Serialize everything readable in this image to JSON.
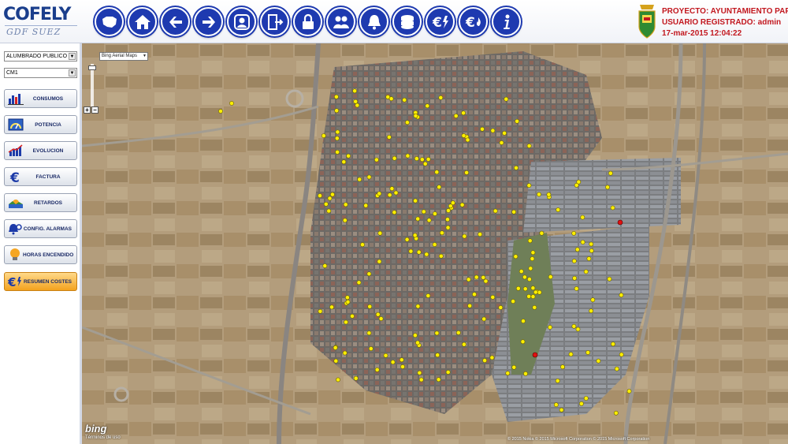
{
  "logo": {
    "main": "COFELY",
    "sub": "GDF SUEZ"
  },
  "toolbar": [
    {
      "name": "spain-map-icon",
      "label": ""
    },
    {
      "name": "home-icon",
      "label": ""
    },
    {
      "name": "arrow-left-icon",
      "label": ""
    },
    {
      "name": "arrow-right-icon",
      "label": ""
    },
    {
      "name": "user-profile-icon",
      "label": ""
    },
    {
      "name": "exit-door-icon",
      "label": ""
    },
    {
      "name": "lock-icon",
      "label": ""
    },
    {
      "name": "users-icon",
      "label": ""
    },
    {
      "name": "alarm-bell-icon",
      "label": ""
    },
    {
      "name": "coins-icon",
      "label": ""
    },
    {
      "name": "euro-electric-icon",
      "label": ""
    },
    {
      "name": "euro-flame-icon",
      "label": ""
    },
    {
      "name": "info-icon",
      "label": ""
    }
  ],
  "project": {
    "line1": "PROYECTO: AYUNTAMIENTO PARLA",
    "line2": "USUARIO REGISTRADO: admin",
    "line3": "17-mar-2015 12:04:22"
  },
  "sidebar": {
    "select1": "ALUMBRADO PUBLICO",
    "select2": "CM1",
    "buttons": [
      {
        "label": "CONSUMOS",
        "icon": "bar-chart-icon"
      },
      {
        "label": "POTENCIA",
        "icon": "gauge-icon"
      },
      {
        "label": "EVOLUCION",
        "icon": "trend-chart-icon"
      },
      {
        "label": "FACTURA",
        "icon": "euro-icon"
      },
      {
        "label": "RETARDOS",
        "icon": "sunrise-icon"
      },
      {
        "label": "CONFIG. ALARMAS",
        "icon": "alarm-config-icon"
      },
      {
        "label": "HORAS ENCENDIDO",
        "icon": "lightbulb-icon"
      },
      {
        "label": "RESUMEN COSTES",
        "icon": "euro-summary-icon"
      }
    ]
  },
  "map": {
    "type_selector": "Bing Aerial Maps",
    "zoom_in": "+",
    "zoom_out": "−",
    "bing_logo": "bing",
    "bing_link": "Términos de uso",
    "copyright": "© 2015 Nokia © 2015 Microsoft Corporation © 2015 Microsoft Corporation",
    "colors": {
      "point_active": "#ffef00",
      "point_alarm": "#e01010"
    }
  }
}
